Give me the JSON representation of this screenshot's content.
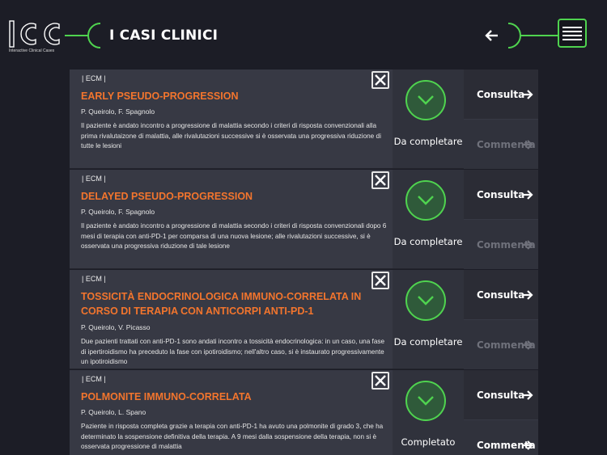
{
  "header": {
    "logo_text": "ICC",
    "logo_subtitle": "Interactive Clinical Cases",
    "title": "I CASI CLINICI"
  },
  "colors": {
    "background": "#1c1d26",
    "accent_green": "#4fd34f",
    "title_orange": "#f3752d",
    "card_bg": "#373944"
  },
  "cases": [
    {
      "tag": "| ECM |",
      "title": "EARLY PSEUDO-PROGRESSION",
      "authors": "P. Queirolo, F. Spagnolo",
      "description": "Il paziente è andato incontro a progressione di malattia secondo i criteri di risposta convenzionali alla prima rivalutaizone di malattia, alle rivalutazioni successive si è osservata una progressiva riduzione di tutte le lesioni",
      "status": "Da completare",
      "consulta_label": "Consulta",
      "commenta_label": "Commenta",
      "commenta_enabled": false
    },
    {
      "tag": "| ECM |",
      "title": "DELAYED PSEUDO-PROGRESSION",
      "authors": "P. Queirolo, F. Spagnolo",
      "description": "Il paziente è andato incontro a progressione di malattia secondo i criteri di risposta convenzionali dopo 6 mesi di terapia con anti-PD-1 per comparsa di una nuova lesione; alle rivalutazioni successive, si è osservata una progressiva riduzione di tale lesione",
      "status": "Da completare",
      "consulta_label": "Consulta",
      "commenta_label": "Commenta",
      "commenta_enabled": false
    },
    {
      "tag": "| ECM |",
      "title": "TOSSICITÀ ENDOCRINOLOGICA IMMUNO-CORRELATA IN CORSO DI TERAPIA CON ANTICORPI ANTI-PD-1",
      "authors": "P. Queirolo, V. Picasso",
      "description": "Due pazienti trattati con anti-PD-1 sono andati incontro a tossicità endocrinologica: in un caso, una fase di ipertiroidismo ha preceduto la fase con ipotiroidismo; nell'altro caso, si è instaurato progressivamente un ipotiroidismo",
      "status": "Da completare",
      "consulta_label": "Consulta",
      "commenta_label": "Commenta",
      "commenta_enabled": false
    },
    {
      "tag": "| ECM |",
      "title": "POLMONITE IMMUNO-CORRELATA",
      "authors": "P. Queirolo, L. Spano",
      "description": "Paziente in risposta completa grazie a terapia con anti-PD-1 ha avuto una polmonite di grado 3, che ha determinato la sospensione definitiva della terapia. A 9 mesi dalla sospensione della terapia, non si è osservata progressione di malattia",
      "status": "Completato",
      "consulta_label": "Consulta",
      "commenta_label": "Commenta",
      "commenta_enabled": true
    }
  ]
}
